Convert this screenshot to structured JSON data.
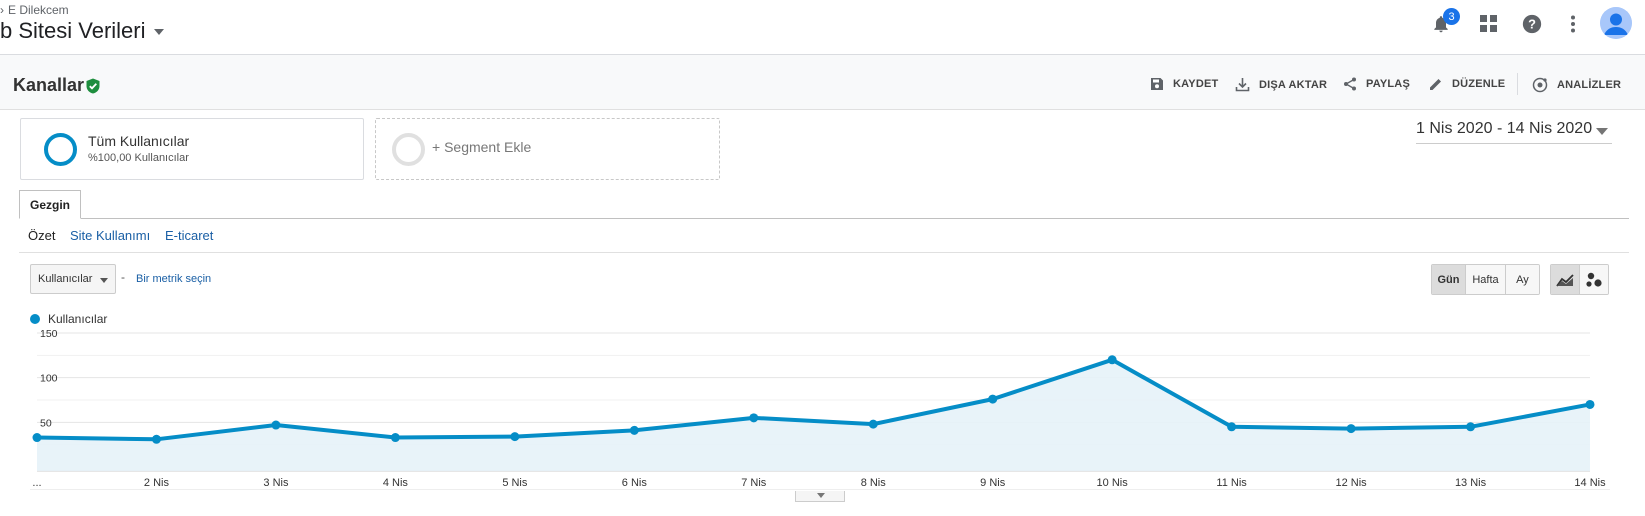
{
  "topbar": {
    "breadcrumb": "E Dilekcem",
    "property_title": "b Sitesi Verileri",
    "notification_count": "3"
  },
  "report": {
    "title": "Kanallar",
    "actions": {
      "save": "KAYDET",
      "export": "DIŞA AKTAR",
      "share": "PAYLAŞ",
      "edit": "DÜZENLE",
      "insights": "ANALİZLER"
    }
  },
  "segments": {
    "active_name": "Tüm Kullanıcılar",
    "active_sub": "%100,00 Kullanıcılar",
    "add_label": "+ Segment Ekle"
  },
  "date_range": "1 Nis 2020 - 14 Nis 2020",
  "tabs": {
    "main": "Gezgin",
    "sub": [
      "Özet",
      "Site Kullanımı",
      "E-ticaret"
    ]
  },
  "metric": {
    "selected": "Kullanıcılar",
    "separator": "-",
    "pick_label": "Bir metrik seçin"
  },
  "granularity": {
    "day": "Gün",
    "week": "Hafta",
    "month": "Ay",
    "selected": "Gün"
  },
  "chart_type_options": [
    "line-chart-icon",
    "motion-chart-icon"
  ],
  "colors": {
    "series": "#058dc7",
    "fill": "#e6f2f8",
    "link": "#1a5fa5",
    "verified": "#1e8e3e"
  },
  "chart_data": {
    "type": "area",
    "series": [
      {
        "name": "Kullanıcılar",
        "values": [
          33,
          31,
          47,
          33,
          34,
          41,
          55,
          48,
          76,
          120,
          45,
          43,
          45,
          70
        ]
      }
    ],
    "x_tick_labels": [
      "...",
      "2 Nis",
      "3 Nis",
      "4 Nis",
      "5 Nis",
      "6 Nis",
      "7 Nis",
      "8 Nis",
      "9 Nis",
      "10 Nis",
      "11 Nis",
      "12 Nis",
      "13 Nis",
      "14 Nis"
    ],
    "y_ticks": [
      50,
      100,
      150
    ],
    "ylim": [
      0,
      150
    ],
    "grid": true
  }
}
